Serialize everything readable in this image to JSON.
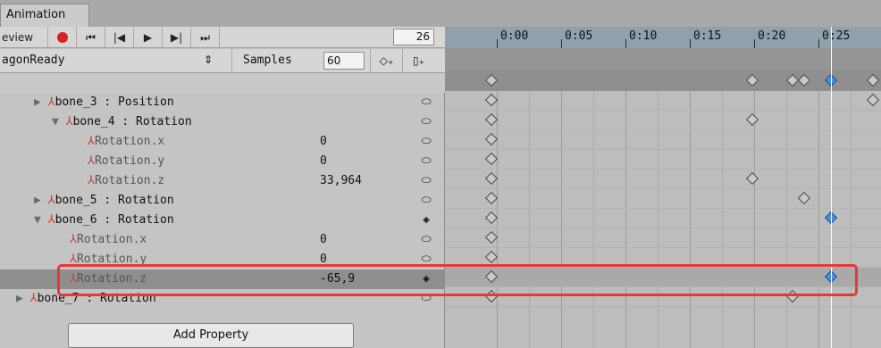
{
  "window": {
    "tab_title": "Animation"
  },
  "toolbar": {
    "preview_label": "eview",
    "frame_value": "26",
    "clip_name": "agonReady",
    "samples_label": "Samples",
    "samples_value": "60"
  },
  "timeline": {
    "ruler_labels": [
      "0:00",
      "0:05",
      "0:10",
      "0:15",
      "0:20",
      "0:25"
    ]
  },
  "properties": [
    {
      "label": "bone_3 : Position",
      "expand": "▶",
      "value": ""
    },
    {
      "label": "bone_4 : Rotation",
      "expand": "▼",
      "value": ""
    },
    {
      "label": "Rotation.x",
      "expand": "",
      "value": "0"
    },
    {
      "label": "Rotation.y",
      "expand": "",
      "value": "0"
    },
    {
      "label": "Rotation.z",
      "expand": "",
      "value": "33,964"
    },
    {
      "label": "bone_5 : Rotation",
      "expand": "▶",
      "value": ""
    },
    {
      "label": "bone_6 : Rotation",
      "expand": "▼",
      "value": ""
    },
    {
      "label": "Rotation.x",
      "expand": "",
      "value": "0"
    },
    {
      "label": "Rotation.y",
      "expand": "",
      "value": "0"
    },
    {
      "label": "Rotation.z",
      "expand": "",
      "value": "-65,9"
    },
    {
      "label": "bone_7 : Rotation",
      "expand": "▶",
      "value": ""
    }
  ],
  "actions": {
    "add_property": "Add Property"
  },
  "colors": {
    "key_selected": "#4a8fe0",
    "highlight": "#e53935"
  }
}
